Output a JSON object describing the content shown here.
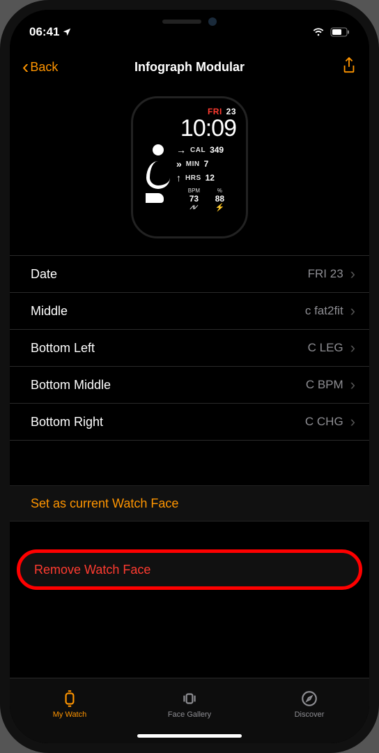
{
  "status": {
    "time": "06:41"
  },
  "nav": {
    "back": "Back",
    "title": "Infograph Modular"
  },
  "preview": {
    "day": "FRI",
    "date": "23",
    "time": "10:09",
    "cal_lbl": "CAL",
    "cal": "349",
    "min_lbl": "MIN",
    "min": "7",
    "hrs_lbl": "HRS",
    "hrs": "12",
    "bpm_lbl": "BPM",
    "bpm": "73",
    "chg_lbl": "%",
    "chg": "88"
  },
  "complications": [
    {
      "label": "Date",
      "value": "FRI 23"
    },
    {
      "label": "Middle",
      "value": "c fat2fit"
    },
    {
      "label": "Bottom Left",
      "value": "C LEG"
    },
    {
      "label": "Bottom Middle",
      "value": "C BPM"
    },
    {
      "label": "Bottom Right",
      "value": "C CHG"
    }
  ],
  "actions": {
    "set_current": "Set as current Watch Face",
    "remove": "Remove Watch Face"
  },
  "tabs": {
    "my_watch": "My Watch",
    "face_gallery": "Face Gallery",
    "discover": "Discover"
  }
}
